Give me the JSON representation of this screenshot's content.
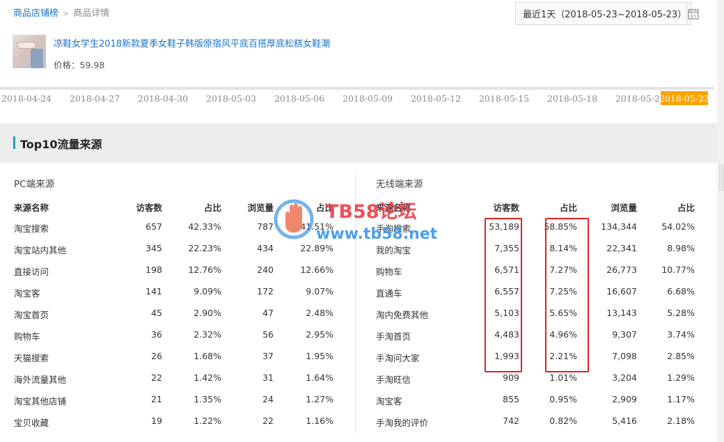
{
  "breadcrumb": {
    "link": "商品店铺榜",
    "separator": ">",
    "current": "商品详情"
  },
  "date_range": {
    "label": "最近1天（2018-05-23~2018-05-23）",
    "calendar_day": "15"
  },
  "product": {
    "title": "凉鞋女学生2018新款夏季女鞋子韩版原宿风平底百搭厚底松糕女鞋潮",
    "price": "价格：59.98"
  },
  "timeline": {
    "dates": [
      "2018-04-24",
      "2018-04-27",
      "2018-04-30",
      "2018-05-03",
      "2018-05-06",
      "2018-05-09",
      "2018-05-12",
      "2018-05-15",
      "2018-05-18",
      "2018-05-21"
    ],
    "active": "2018-05-23"
  },
  "section": {
    "title": "Top10流量来源"
  },
  "pc": {
    "title": "PC端来源",
    "headers": [
      "来源名称",
      "访客数",
      "占比",
      "浏览量",
      "占比"
    ],
    "rows": [
      [
        "淘宝搜索",
        "657",
        "42.33%",
        "787",
        "41.51%"
      ],
      [
        "淘宝站内其他",
        "345",
        "22.23%",
        "434",
        "22.89%"
      ],
      [
        "直接访问",
        "198",
        "12.76%",
        "240",
        "12.66%"
      ],
      [
        "淘宝客",
        "141",
        "9.09%",
        "172",
        "9.07%"
      ],
      [
        "淘宝首页",
        "45",
        "2.90%",
        "47",
        "2.48%"
      ],
      [
        "购物车",
        "36",
        "2.32%",
        "56",
        "2.95%"
      ],
      [
        "天猫搜索",
        "26",
        "1.68%",
        "37",
        "1.95%"
      ],
      [
        "海外流量其他",
        "22",
        "1.42%",
        "31",
        "1.64%"
      ],
      [
        "淘宝其他店铺",
        "21",
        "1.35%",
        "24",
        "1.27%"
      ],
      [
        "宝贝收藏",
        "19",
        "1.22%",
        "22",
        "1.16%"
      ]
    ]
  },
  "mobile": {
    "title": "无线端来源",
    "headers": [
      "来源名称",
      "访客数",
      "占比",
      "浏览量",
      "占比"
    ],
    "rows": [
      [
        "手淘搜索",
        "53,189",
        "58.85%",
        "134,344",
        "54.02%"
      ],
      [
        "我的淘宝",
        "7,355",
        "8.14%",
        "22,341",
        "8.98%"
      ],
      [
        "购物车",
        "6,571",
        "7.27%",
        "26,773",
        "10.77%"
      ],
      [
        "直通车",
        "6,557",
        "7.25%",
        "16,607",
        "6.68%"
      ],
      [
        "淘内免费其他",
        "5,103",
        "5.65%",
        "13,143",
        "5.28%"
      ],
      [
        "手淘首页",
        "4,483",
        "4.96%",
        "9,307",
        "3.74%"
      ],
      [
        "手淘问大家",
        "1,993",
        "2.21%",
        "7,098",
        "2.85%"
      ],
      [
        "手淘旺信",
        "909",
        "1.01%",
        "3,204",
        "1.29%"
      ],
      [
        "淘宝客",
        "855",
        "0.95%",
        "2,909",
        "1.17%"
      ],
      [
        "手淘我的评价",
        "742",
        "0.82%",
        "5,416",
        "2.18%"
      ]
    ]
  },
  "watermark": {
    "line1": "TB58论坛",
    "line2": "www.tb58.net"
  },
  "colors": {
    "link": "#1a73c9",
    "accent": "#1aa3b8",
    "active_date": "#f8a300",
    "highlight": "#e02020"
  }
}
